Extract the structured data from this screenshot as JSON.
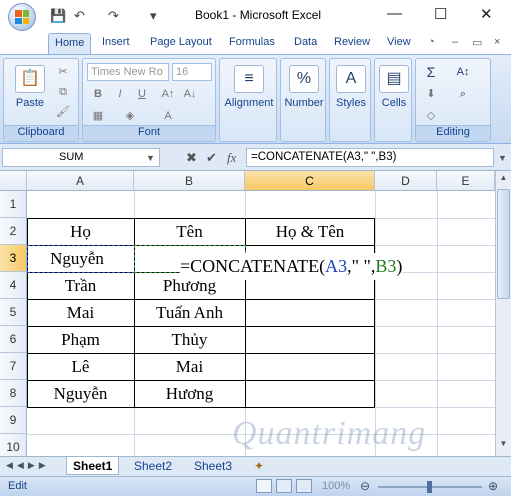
{
  "window": {
    "title": "Book1 - Microsoft Excel",
    "minimize_glyph": "—",
    "maximize_glyph": "☐",
    "close_glyph": "✕"
  },
  "quick_access": {
    "save_icon": "💾",
    "undo_icon": "↶",
    "redo_icon": "↷",
    "customize_icon": "▾"
  },
  "ribbon_tabs": [
    "Home",
    "Insert",
    "Page Layout",
    "Formulas",
    "Data",
    "Review",
    "View"
  ],
  "ribbon": {
    "clipboard": {
      "label": "Clipboard",
      "paste": "Paste"
    },
    "font": {
      "label": "Font",
      "name": "Times New Ro",
      "size": "16",
      "bold": "B",
      "italic": "I",
      "underline": "U"
    },
    "alignment": {
      "label": "Alignment"
    },
    "number": {
      "label": "Number",
      "icon": "%"
    },
    "styles": {
      "label": "Styles"
    },
    "cells": {
      "label": "Cells"
    },
    "editing": {
      "label": "Editing",
      "sum": "Σ"
    }
  },
  "formula_bar": {
    "name_box": "SUM",
    "cancel": "✖",
    "enter": "✔",
    "fx": "fx",
    "formula": "=CONCATENATE(A3,\" \",B3)"
  },
  "columns": [
    "A",
    "B",
    "C",
    "D",
    "E"
  ],
  "rows": [
    "1",
    "2",
    "3",
    "4",
    "5",
    "6",
    "7",
    "8",
    "9",
    "10"
  ],
  "cells": {
    "A2": "Họ",
    "B2": "Tên",
    "C2": "Họ & Tên",
    "A3": "Nguyễn",
    "A4": "Trần",
    "B4": "Phương",
    "A5": "Mai",
    "B5": "Tuấn Anh",
    "A6": "Phạm",
    "B6": "Thủy",
    "A7": "Lê",
    "B7": "Mai",
    "A8": "Nguyễn",
    "B8": "Hương"
  },
  "in_cell_edit": {
    "prefix": "=CONCATENATE(",
    "ref1": "A3",
    "mid": ",\" \",",
    "ref2": "B3",
    "suffix": ")",
    "ref1_color": "#1f3fbf",
    "ref2_color": "#1f7a1f"
  },
  "sheet_tabs": [
    "Sheet1",
    "Sheet2",
    "Sheet3"
  ],
  "status": {
    "mode": "Edit",
    "zoom": "100%"
  },
  "watermark": "Quantrimang"
}
